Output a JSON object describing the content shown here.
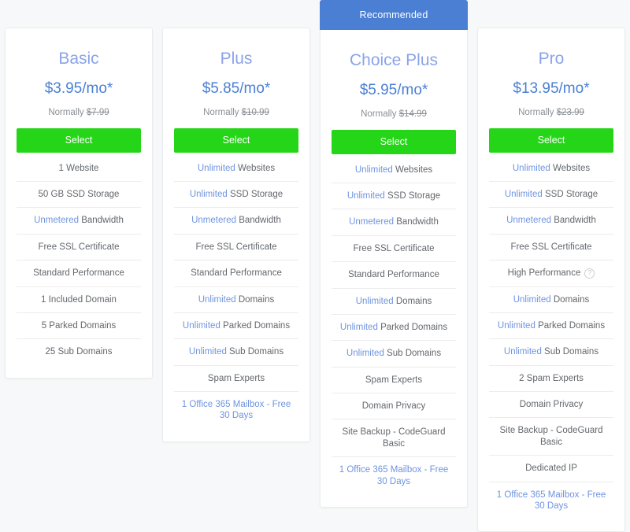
{
  "colors": {
    "accent_blue": "#4a7fd4",
    "title_blue": "#8ba4e8",
    "highlight_blue": "#6f94e0",
    "select_green": "#25d517",
    "page_background": "#f7f8f9",
    "card_background": "#ffffff",
    "divider": "#ececee",
    "body_text": "#63676c",
    "muted_text": "#8a8f95"
  },
  "labels": {
    "normally_prefix": "Normally",
    "recommended_badge": "Recommended",
    "info_icon_glyph": "?"
  },
  "plans": [
    {
      "id": "basic",
      "name": "Basic",
      "price": "$3.95/mo*",
      "normally_price": "$7.99",
      "select_label": "Select",
      "recommended": false,
      "features": [
        {
          "highlight": "",
          "text": "1 Website",
          "link": false,
          "info": false
        },
        {
          "highlight": "",
          "text": "50 GB SSD Storage",
          "link": false,
          "info": false
        },
        {
          "highlight": "Unmetered",
          "text": "Bandwidth",
          "link": false,
          "info": false
        },
        {
          "highlight": "",
          "text": "Free SSL Certificate",
          "link": false,
          "info": false
        },
        {
          "highlight": "",
          "text": "Standard Performance",
          "link": false,
          "info": false
        },
        {
          "highlight": "",
          "text": "1 Included Domain",
          "link": false,
          "info": false
        },
        {
          "highlight": "",
          "text": "5 Parked Domains",
          "link": false,
          "info": false
        },
        {
          "highlight": "",
          "text": "25 Sub Domains",
          "link": false,
          "info": false
        }
      ]
    },
    {
      "id": "plus",
      "name": "Plus",
      "price": "$5.85/mo*",
      "normally_price": "$10.99",
      "select_label": "Select",
      "recommended": false,
      "features": [
        {
          "highlight": "Unlimited",
          "text": "Websites",
          "link": false,
          "info": false
        },
        {
          "highlight": "Unlimited",
          "text": "SSD Storage",
          "link": false,
          "info": false
        },
        {
          "highlight": "Unmetered",
          "text": "Bandwidth",
          "link": false,
          "info": false
        },
        {
          "highlight": "",
          "text": "Free SSL Certificate",
          "link": false,
          "info": false
        },
        {
          "highlight": "",
          "text": "Standard Performance",
          "link": false,
          "info": false
        },
        {
          "highlight": "Unlimited",
          "text": "Domains",
          "link": false,
          "info": false
        },
        {
          "highlight": "Unlimited",
          "text": "Parked Domains",
          "link": false,
          "info": false
        },
        {
          "highlight": "Unlimited",
          "text": "Sub Domains",
          "link": false,
          "info": false
        },
        {
          "highlight": "",
          "text": "Spam Experts",
          "link": false,
          "info": false
        },
        {
          "highlight": "",
          "text": "1 Office 365 Mailbox - Free 30 Days",
          "link": true,
          "info": false
        }
      ]
    },
    {
      "id": "choice-plus",
      "name": "Choice Plus",
      "price": "$5.95/mo*",
      "normally_price": "$14.99",
      "select_label": "Select",
      "recommended": true,
      "features": [
        {
          "highlight": "Unlimited",
          "text": "Websites",
          "link": false,
          "info": false
        },
        {
          "highlight": "Unlimited",
          "text": "SSD Storage",
          "link": false,
          "info": false
        },
        {
          "highlight": "Unmetered",
          "text": "Bandwidth",
          "link": false,
          "info": false
        },
        {
          "highlight": "",
          "text": "Free SSL Certificate",
          "link": false,
          "info": false
        },
        {
          "highlight": "",
          "text": "Standard Performance",
          "link": false,
          "info": false
        },
        {
          "highlight": "Unlimited",
          "text": "Domains",
          "link": false,
          "info": false
        },
        {
          "highlight": "Unlimited",
          "text": "Parked Domains",
          "link": false,
          "info": false
        },
        {
          "highlight": "Unlimited",
          "text": "Sub Domains",
          "link": false,
          "info": false
        },
        {
          "highlight": "",
          "text": "Spam Experts",
          "link": false,
          "info": false
        },
        {
          "highlight": "",
          "text": "Domain Privacy",
          "link": false,
          "info": false
        },
        {
          "highlight": "",
          "text": "Site Backup - CodeGuard Basic",
          "link": false,
          "info": false
        },
        {
          "highlight": "",
          "text": "1 Office 365 Mailbox - Free 30 Days",
          "link": true,
          "info": false
        }
      ]
    },
    {
      "id": "pro",
      "name": "Pro",
      "price": "$13.95/mo*",
      "normally_price": "$23.99",
      "select_label": "Select",
      "recommended": false,
      "features": [
        {
          "highlight": "Unlimited",
          "text": "Websites",
          "link": false,
          "info": false
        },
        {
          "highlight": "Unlimited",
          "text": "SSD Storage",
          "link": false,
          "info": false
        },
        {
          "highlight": "Unmetered",
          "text": "Bandwidth",
          "link": false,
          "info": false
        },
        {
          "highlight": "",
          "text": "Free SSL Certificate",
          "link": false,
          "info": false
        },
        {
          "highlight": "",
          "text": "High Performance",
          "link": false,
          "info": true
        },
        {
          "highlight": "Unlimited",
          "text": "Domains",
          "link": false,
          "info": false
        },
        {
          "highlight": "Unlimited",
          "text": "Parked Domains",
          "link": false,
          "info": false
        },
        {
          "highlight": "Unlimited",
          "text": "Sub Domains",
          "link": false,
          "info": false
        },
        {
          "highlight": "",
          "text": "2 Spam Experts",
          "link": false,
          "info": false
        },
        {
          "highlight": "",
          "text": "Domain Privacy",
          "link": false,
          "info": false
        },
        {
          "highlight": "",
          "text": "Site Backup - CodeGuard Basic",
          "link": false,
          "info": false
        },
        {
          "highlight": "",
          "text": "Dedicated IP",
          "link": false,
          "info": false
        },
        {
          "highlight": "",
          "text": "1 Office 365 Mailbox - Free 30 Days",
          "link": true,
          "info": false
        }
      ]
    }
  ]
}
